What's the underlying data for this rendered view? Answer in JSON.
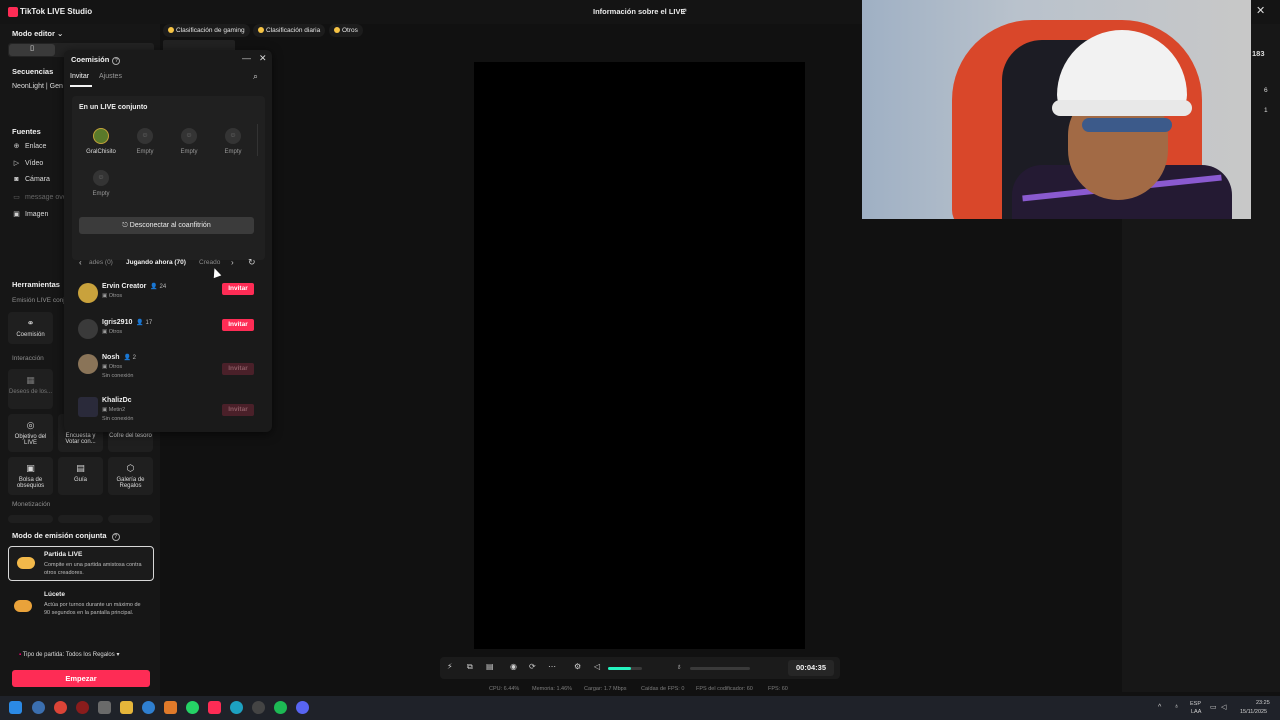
{
  "app": {
    "title": "TikTok LIVE Studio",
    "live_info": "Información sobre el LIVE"
  },
  "sidebar": {
    "editor_mode": "Modo editor ⌄",
    "sequences_title": "Secuencias",
    "sequence_item": "NeonLight | Gen",
    "sources_title": "Fuentes",
    "sources": [
      {
        "label": "Enlace",
        "icon": "link-icon"
      },
      {
        "label": "Vídeo",
        "icon": "play-icon"
      },
      {
        "label": "Cámara",
        "icon": "camera-icon"
      },
      {
        "label": "message ove",
        "icon": "message-icon"
      },
      {
        "label": "Imagen",
        "icon": "image-icon"
      }
    ],
    "tools_title": "Herramientas",
    "emission_label": "Emisión LIVE conj",
    "cohost_tool": "Coemisión",
    "interaction_label": "Interacción",
    "wishes_tool": "Deseos de los...",
    "tool_row_1": [
      "Objetivo del LIVE",
      "Encuesta y Votar con...",
      "Cofre del tesoro"
    ],
    "tool_row_2": [
      "Bolsa de obsequios",
      "Guía",
      "Galería de Regalos"
    ],
    "monetization_label": "Monetización",
    "joint_mode_title": "Modo de emisión conjunta",
    "partida_title": "Partida LIVE",
    "partida_desc": "Compite en una partida amistosa contra otros creadores.",
    "lucete_title": "Lúcete",
    "lucete_desc": "Actúa por turnos durante un máximo de 90 segundos en la pantalla principal.",
    "match_type": "Tipo de partida: Todos los Regalos",
    "start_button": "Empezar"
  },
  "chips": [
    "Clasificación de gaming",
    "Clasificación diaria",
    "Otros"
  ],
  "panel": {
    "title": "Coemisión",
    "tabs": [
      "Invitar",
      "Ajustes"
    ],
    "joint_title": "En un LIVE conjunto",
    "slots": [
      {
        "name": "GralChisito",
        "filled": true
      },
      {
        "name": "Empty",
        "filled": false
      },
      {
        "name": "Empty",
        "filled": false
      },
      {
        "name": "Empty",
        "filled": false
      },
      {
        "name": "Empty",
        "filled": false
      }
    ],
    "disconnect_button": "Desconectar al coanfitrión",
    "categories": [
      "ades (0)",
      "Jugando ahora (70)",
      "Creado"
    ],
    "creators": [
      {
        "name": "Ervin Creator",
        "count": "24",
        "category": "Otros",
        "status": "",
        "invite": "Invitar",
        "enabled": true
      },
      {
        "name": "Igris2910",
        "count": "17",
        "category": "Otros",
        "status": "",
        "invite": "Invitar",
        "enabled": true
      },
      {
        "name": "Nosh",
        "count": "2",
        "category": "Otros",
        "status": "Sin conexión",
        "invite": "Invitar",
        "enabled": false
      },
      {
        "name": "KhalizDc",
        "count": "",
        "category": "Metin2",
        "status": "Sin conexión",
        "invite": "Invitar",
        "enabled": false
      }
    ]
  },
  "rightbar": {
    "viewers": "183",
    "value_a": "6",
    "value_b": "1"
  },
  "toolbar": {
    "timer": "00:04:35",
    "volume_level": 0.68,
    "stats": [
      "CPU: 6.44%",
      "Memoria: 1.46%",
      "Cargar: 1.7 Mbps",
      "Caídas de FPS: 0",
      "FPS del codificador: 60",
      "FPS: 60"
    ]
  },
  "taskbar": {
    "lang_1": "ESP",
    "lang_2": "LAA",
    "time": "23:25",
    "date": "15/11/2025"
  },
  "colors": {
    "accent": "#fe2c55",
    "volume": "#25f4c0",
    "background": "#111111"
  }
}
